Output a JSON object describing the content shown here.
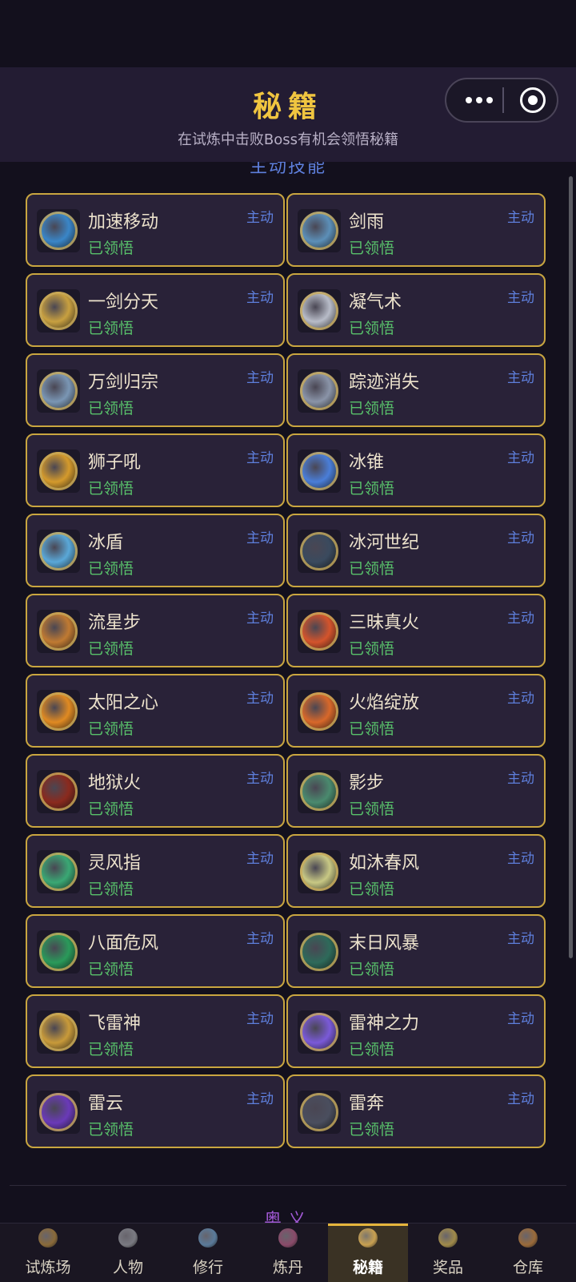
{
  "header": {
    "title": "秘籍",
    "subtitle": "在试炼中击败Boss有机会领悟秘籍"
  },
  "sections": {
    "active_title": "主动技能",
    "next_title": "奥义"
  },
  "skills": [
    {
      "name": "加速移动",
      "status": "已领悟",
      "type": "主动",
      "icon": "swift-move-icon",
      "color": "#3a86c8"
    },
    {
      "name": "剑雨",
      "status": "已领悟",
      "type": "主动",
      "icon": "sword-rain-icon",
      "color": "#5c8fb8"
    },
    {
      "name": "一剑分天",
      "status": "已领悟",
      "type": "主动",
      "icon": "sky-splitting-sword-icon",
      "color": "#c8a040"
    },
    {
      "name": "凝气术",
      "status": "已领悟",
      "type": "主动",
      "icon": "qi-condense-icon",
      "color": "#b8bcc8"
    },
    {
      "name": "万剑归宗",
      "status": "已领悟",
      "type": "主动",
      "icon": "myriad-swords-icon",
      "color": "#7a96b4"
    },
    {
      "name": "踪迹消失",
      "status": "已领悟",
      "type": "主动",
      "icon": "vanish-icon",
      "color": "#8a94a8"
    },
    {
      "name": "狮子吼",
      "status": "已领悟",
      "type": "主动",
      "icon": "lion-roar-icon",
      "color": "#d49a2c"
    },
    {
      "name": "冰锥",
      "status": "已领悟",
      "type": "主动",
      "icon": "ice-cone-icon",
      "color": "#4a7ed8"
    },
    {
      "name": "冰盾",
      "status": "已领悟",
      "type": "主动",
      "icon": "ice-shield-icon",
      "color": "#5aa8d8"
    },
    {
      "name": "冰河世纪",
      "status": "已领悟",
      "type": "主动",
      "icon": "ice-age-icon",
      "color": "#3a4a5e"
    },
    {
      "name": "流星步",
      "status": "已领悟",
      "type": "主动",
      "icon": "meteor-step-icon",
      "color": "#c07a32"
    },
    {
      "name": "三昧真火",
      "status": "已领悟",
      "type": "主动",
      "icon": "samadhi-fire-icon",
      "color": "#d4542c"
    },
    {
      "name": "太阳之心",
      "status": "已领悟",
      "type": "主动",
      "icon": "sun-heart-icon",
      "color": "#e08a22"
    },
    {
      "name": "火焰绽放",
      "status": "已领悟",
      "type": "主动",
      "icon": "flame-bloom-icon",
      "color": "#d8682a"
    },
    {
      "name": "地狱火",
      "status": "已领悟",
      "type": "主动",
      "icon": "hellfire-icon",
      "color": "#8a2a1e"
    },
    {
      "name": "影步",
      "status": "已领悟",
      "type": "主动",
      "icon": "shadow-step-icon",
      "color": "#4a8a6e"
    },
    {
      "name": "灵风指",
      "status": "已领悟",
      "type": "主动",
      "icon": "spirit-wind-finger-icon",
      "color": "#3aa874"
    },
    {
      "name": "如沐春风",
      "status": "已领悟",
      "type": "主动",
      "icon": "spring-breeze-icon",
      "color": "#c8c884"
    },
    {
      "name": "八面危风",
      "status": "已领悟",
      "type": "主动",
      "icon": "eight-winds-icon",
      "color": "#2a9a5a"
    },
    {
      "name": "末日风暴",
      "status": "已领悟",
      "type": "主动",
      "icon": "doom-storm-icon",
      "color": "#2e6a5a"
    },
    {
      "name": "飞雷神",
      "status": "已领悟",
      "type": "主动",
      "icon": "flying-thunder-icon",
      "color": "#c89a3a"
    },
    {
      "name": "雷神之力",
      "status": "已领悟",
      "type": "主动",
      "icon": "thunder-god-icon",
      "color": "#7a5ad8"
    },
    {
      "name": "雷云",
      "status": "已领悟",
      "type": "主动",
      "icon": "thunder-cloud-icon",
      "color": "#6a3ab8"
    },
    {
      "name": "雷奔",
      "status": "已领悟",
      "type": "主动",
      "icon": "thunder-dash-icon",
      "color": "#4a4e5e"
    }
  ],
  "tabs": [
    {
      "label": "试炼场",
      "icon": "arena-icon",
      "color": "#8a6a3a"
    },
    {
      "label": "人物",
      "icon": "character-icon",
      "color": "#7a7a82"
    },
    {
      "label": "修行",
      "icon": "cultivation-icon",
      "color": "#5a7a9a"
    },
    {
      "label": "炼丹",
      "icon": "alchemy-icon",
      "color": "#8a4a6a"
    },
    {
      "label": "秘籍",
      "icon": "scroll-icon",
      "color": "#c8a050",
      "active": true
    },
    {
      "label": "奖品",
      "icon": "reward-icon",
      "color": "#a08a4a"
    },
    {
      "label": "仓库",
      "icon": "warehouse-icon",
      "color": "#9a6a3a"
    }
  ],
  "accent_color": "#c9a640"
}
